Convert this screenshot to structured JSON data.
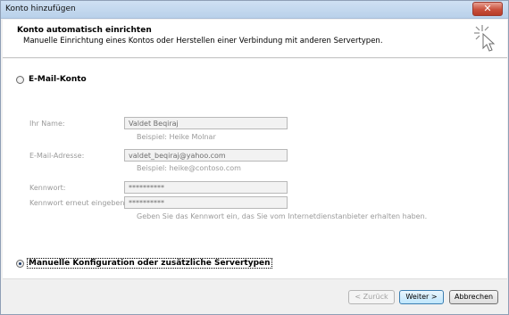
{
  "window": {
    "title": "Konto hinzufügen",
    "close_label": "✕"
  },
  "header": {
    "title": "Konto automatisch einrichten",
    "subtitle": "Manuelle Einrichtung eines Kontos oder Herstellen einer Verbindung mit anderen Servertypen."
  },
  "email_option": {
    "label": "E-Mail-Konto",
    "selected": false
  },
  "form": {
    "name": {
      "label": "Ihr Name:",
      "value": "Valdet Beqiraj",
      "hint": "Beispiel: Heike Molnar"
    },
    "email": {
      "label": "E-Mail-Adresse:",
      "value": "valdet_beqiraj@yahoo.com",
      "hint": "Beispiel: heike@contoso.com"
    },
    "password": {
      "label": "Kennwort:",
      "value": "**********"
    },
    "password_repeat": {
      "label": "Kennwort erneut eingeben:",
      "value": "**********"
    },
    "password_hint": "Geben Sie das Kennwort ein, das Sie vom Internetdienstanbieter erhalten haben."
  },
  "manual_option": {
    "label": "Manuelle Konfiguration oder zusätzliche Servertypen",
    "selected": true
  },
  "footer": {
    "back_label": "< Zurück",
    "next_label": "Weiter >",
    "cancel_label": "Abbrechen"
  }
}
